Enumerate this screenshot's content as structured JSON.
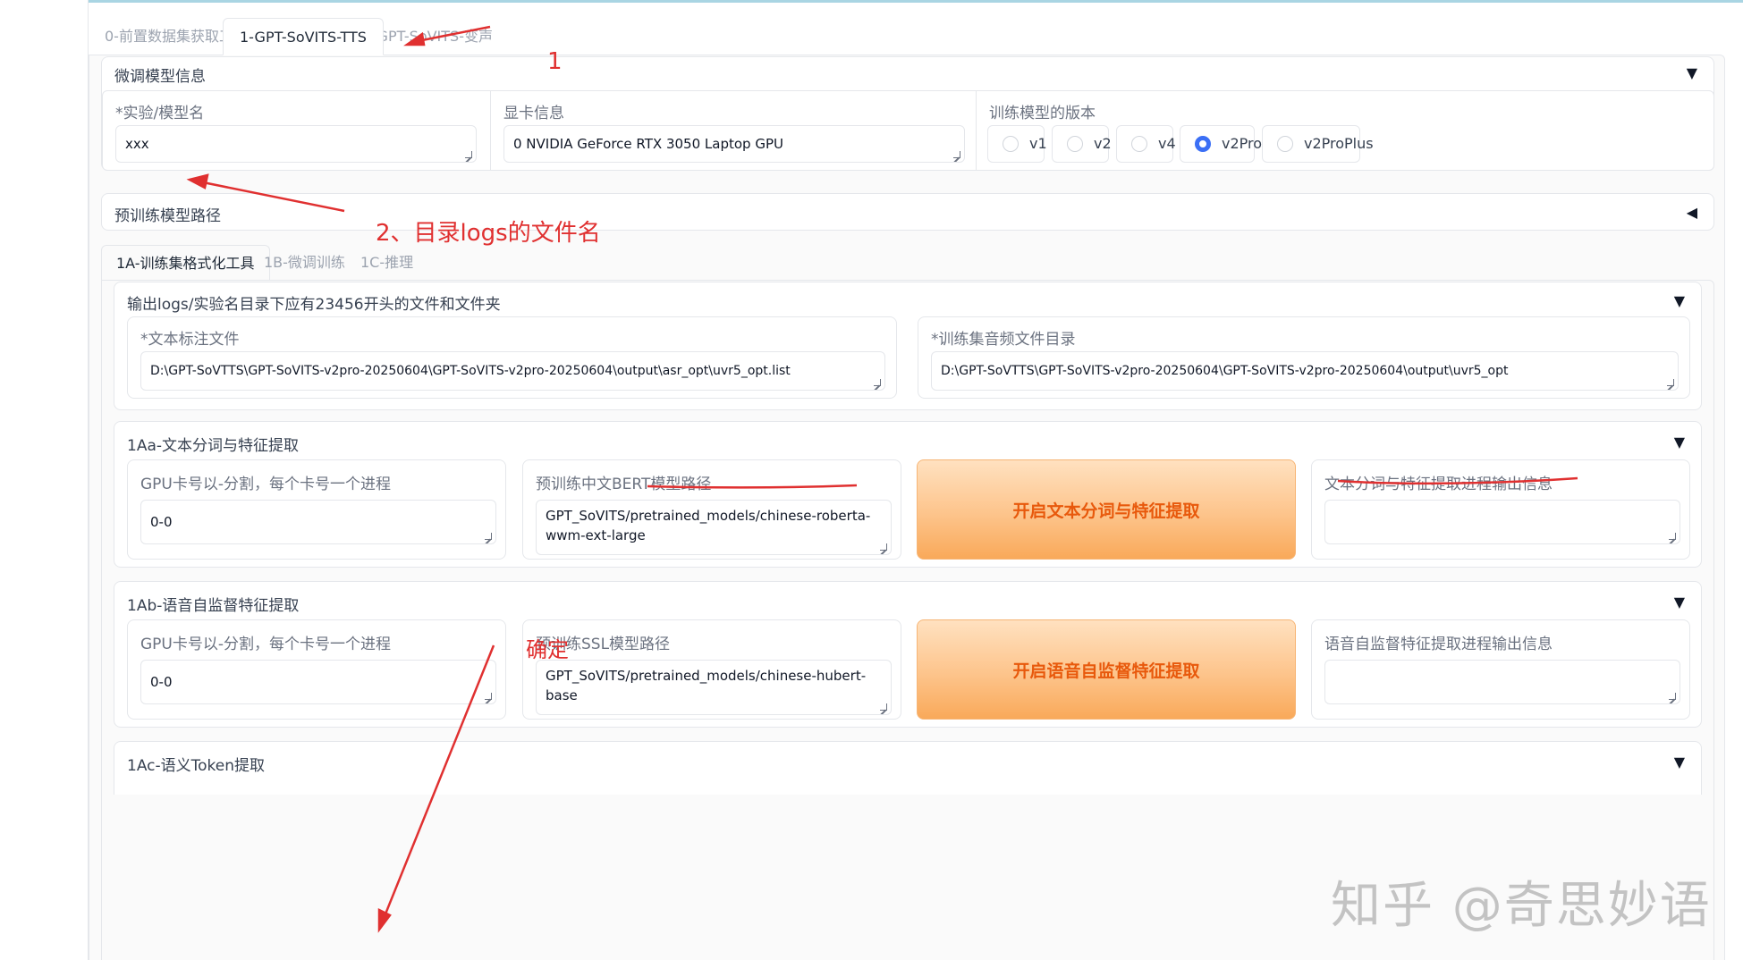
{
  "tabs": [
    {
      "label": "0-前置数据集获取工具",
      "active": false
    },
    {
      "label": "1-GPT-SoVITS-TTS",
      "active": true
    },
    {
      "label": "2-GPT-SoVITS-变声",
      "active": false
    }
  ],
  "finetune_info": {
    "title": "微调模型信息",
    "arrow": "▼",
    "experiment": {
      "label": "*实验/模型名",
      "value": "xxx"
    },
    "gpu": {
      "label": "显卡信息",
      "value": "0 NVIDIA GeForce RTX 3050 Laptop GPU"
    },
    "version": {
      "label": "训练模型的版本",
      "options": [
        "v1",
        "v2",
        "v4",
        "v2Pro",
        "v2ProPlus"
      ],
      "selected": "v2Pro"
    }
  },
  "pretrained_path": {
    "title": "预训练模型路径",
    "arrow": "◀"
  },
  "sub_tabs": [
    {
      "label": "1A-训练集格式化工具",
      "active": true
    },
    {
      "label": "1B-微调训练",
      "active": false
    },
    {
      "label": "1C-推理",
      "active": false
    }
  ],
  "output_section": {
    "title": "输出logs/实验名目录下应有23456开头的文件和文件夹",
    "arrow": "▼",
    "text_label_file": {
      "label": "*文本标注文件",
      "value": "D:\\GPT-SoVTTS\\GPT-SoVITS-v2pro-20250604\\GPT-SoVITS-v2pro-20250604\\output\\asr_opt\\uvr5_opt.list"
    },
    "audio_dir": {
      "label": "*训练集音频文件目录",
      "value": "D:\\GPT-SoVTTS\\GPT-SoVITS-v2pro-20250604\\GPT-SoVITS-v2pro-20250604\\output\\uvr5_opt"
    }
  },
  "section_1aa": {
    "title": "1Aa-文本分词与特征提取",
    "arrow": "▼",
    "gpu_label": "GPU卡号以-分割，每个卡号一个进程",
    "gpu_value": "0-0",
    "bert_label": "预训练中文BERT模型路径",
    "bert_value": "GPT_SoVITS/pretrained_models/chinese-roberta-wwm-ext-large",
    "button": "开启文本分词与特征提取",
    "output_label": "文本分词与特征提取进程输出信息",
    "output_value": ""
  },
  "section_1ab": {
    "title": "1Ab-语音自监督特征提取",
    "arrow": "▼",
    "gpu_label": "GPU卡号以-分割，每个卡号一个进程",
    "gpu_value": "0-0",
    "ssl_label": "预训练SSL模型路径",
    "ssl_value": "GPT_SoVITS/pretrained_models/chinese-hubert-base",
    "button": "开启语音自监督特征提取",
    "output_label": "语音自监督特征提取进程输出信息",
    "output_value": ""
  },
  "section_1ac": {
    "title": "1Ac-语义Token提取",
    "arrow": "▼"
  },
  "annotations": {
    "step1": "1",
    "step2": "2、目录logs的文件名",
    "confirm": "确定"
  },
  "watermark": "知乎 @奇思妙语",
  "colors": {
    "annotation": "#e03030",
    "accent": "#3b6ff5",
    "button_text": "#e8590c"
  }
}
